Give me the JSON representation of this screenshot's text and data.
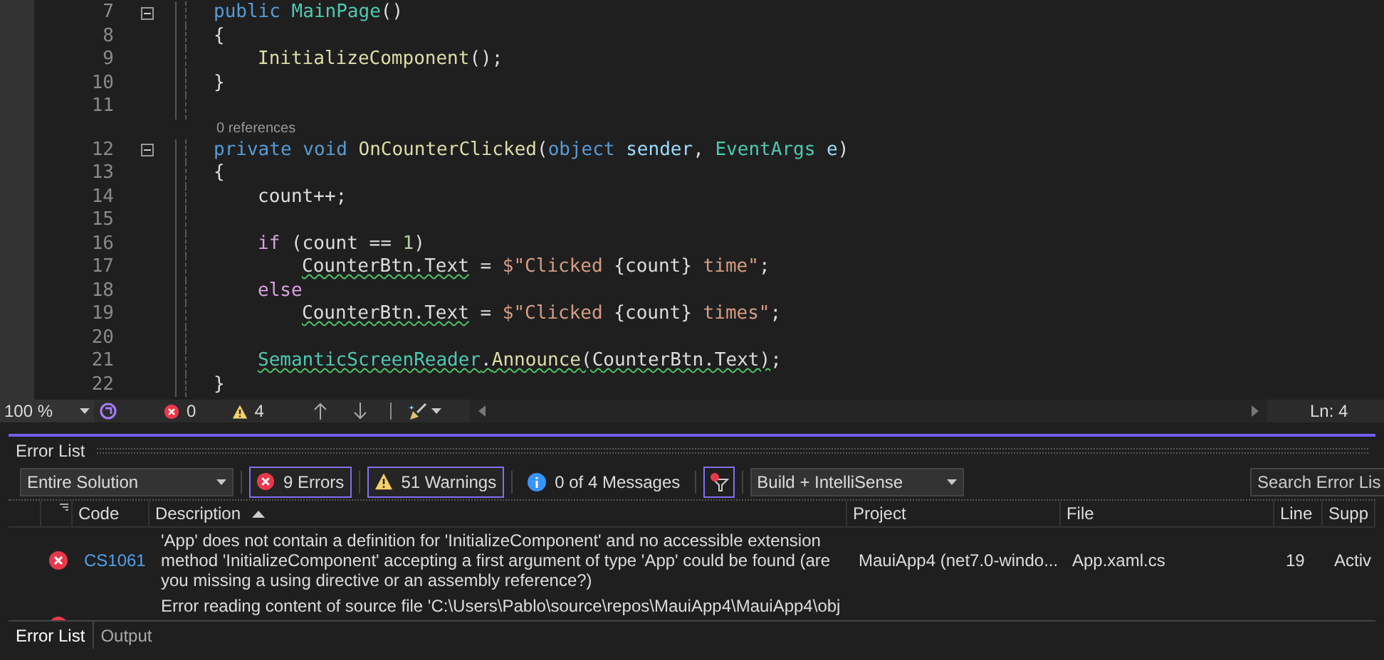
{
  "editor": {
    "lines": [
      {
        "number": "7",
        "fold": true,
        "tokens": [
          {
            "text": "public ",
            "kind": "kw"
          },
          {
            "text": "MainPage",
            "kind": "type"
          },
          {
            "text": "()",
            "kind": "plain"
          }
        ]
      },
      {
        "number": "8",
        "fold": false,
        "tokens": [
          {
            "text": "{",
            "kind": "plain"
          }
        ],
        "children": [
          {
            "number": "9",
            "fold": false,
            "tokens": [
              {
                "text": "InitializeComponent",
                "kind": "method"
              },
              {
                "text": "();",
                "kind": "plain"
              }
            ]
          }
        ]
      },
      {
        "number": "10",
        "fold": false,
        "tokens": [
          {
            "text": "}",
            "kind": "plain"
          }
        ]
      },
      {
        "number": "11",
        "fold": false
      },
      {
        "number": "12",
        "fold": true,
        "lens": "0 references",
        "tokens": [
          {
            "text": "private void ",
            "kind": "kw"
          },
          {
            "text": "OnCounterClicked",
            "kind": "method"
          },
          {
            "text": "(",
            "kind": "plain"
          },
          {
            "text": "object ",
            "kind": "kw"
          },
          {
            "text": "sender",
            "kind": "param"
          },
          {
            "text": ", ",
            "kind": "plain"
          },
          {
            "text": "EventArgs ",
            "kind": "type"
          },
          {
            "text": "e",
            "kind": "param"
          },
          {
            "text": ")",
            "kind": "plain"
          }
        ]
      },
      {
        "number": "13",
        "fold": false,
        "tokens": [
          {
            "text": "{",
            "kind": "plain"
          }
        ],
        "children": [
          {
            "number": "14",
            "fold": false,
            "tokens": [
              {
                "text": "count++;",
                "kind": "plain"
              }
            ]
          },
          {
            "number": "15",
            "fold": false
          },
          {
            "number": "16",
            "fold": false,
            "tokens": [
              {
                "text": "if ",
                "kind": "ctrl"
              },
              {
                "text": "(count == ",
                "kind": "plain"
              },
              {
                "text": "1",
                "kind": "num"
              },
              {
                "text": ")",
                "kind": "plain"
              }
            ],
            "children": [
              {
                "number": "17",
                "fold": false,
                "tokens": [
                  {
                    "text": "CounterBtn.Text",
                    "kind": "plain",
                    "squiggle": true
                  },
                  {
                    "text": " = ",
                    "kind": "plain"
                  },
                  {
                    "text": "$\"Clicked ",
                    "kind": "str"
                  },
                  {
                    "text": "{count}",
                    "kind": "plain"
                  },
                  {
                    "text": " time\"",
                    "kind": "str"
                  },
                  {
                    "text": ";",
                    "kind": "plain"
                  }
                ]
              }
            ]
          },
          {
            "number": "18",
            "fold": false,
            "tokens": [
              {
                "text": "else",
                "kind": "ctrl"
              }
            ],
            "children": [
              {
                "number": "19",
                "fold": false,
                "tokens": [
                  {
                    "text": "CounterBtn.Text",
                    "kind": "plain",
                    "squiggle": true
                  },
                  {
                    "text": " = ",
                    "kind": "plain"
                  },
                  {
                    "text": "$\"Clicked ",
                    "kind": "str"
                  },
                  {
                    "text": "{count}",
                    "kind": "plain"
                  },
                  {
                    "text": " times\"",
                    "kind": "str"
                  },
                  {
                    "text": ";",
                    "kind": "plain"
                  }
                ]
              }
            ]
          },
          {
            "number": "20",
            "fold": false
          },
          {
            "number": "21",
            "fold": false,
            "tokens": [
              {
                "text": "SemanticScreenReader",
                "kind": "type",
                "squiggle": true
              },
              {
                "text": ".",
                "kind": "plain",
                "squiggle": true
              },
              {
                "text": "Announce",
                "kind": "method",
                "squiggle": true
              },
              {
                "text": "(CounterBtn.Text)",
                "kind": "plain",
                "squiggle": true
              },
              {
                "text": ";",
                "kind": "plain"
              }
            ]
          }
        ]
      },
      {
        "number": "22",
        "fold": false,
        "tokens": [
          {
            "text": "}",
            "kind": "plain"
          }
        ]
      }
    ]
  },
  "status_bar": {
    "zoom": "100 %",
    "errors": "0",
    "warnings": "4",
    "position": "Ln: 4"
  },
  "error_list": {
    "title": "Error List",
    "scope": "Entire Solution",
    "filters": [
      {
        "kind": "error",
        "label": "9 Errors",
        "selected": true
      },
      {
        "kind": "warning",
        "label": "51 Warnings",
        "selected": true
      },
      {
        "kind": "info",
        "label": "0 of 4 Messages",
        "selected": false
      }
    ],
    "filter_active": true,
    "source": "Build + IntelliSense",
    "search": {
      "placeholder": "Search Error Lis"
    },
    "columns": [
      "Code",
      "Description",
      "Project",
      "File",
      "Line",
      "Supp"
    ],
    "rows": [
      {
        "kind": "error",
        "code": "CS1061",
        "description": "'App' does not contain a definition for 'InitializeComponent' and no accessible extension method 'InitializeComponent' accepting a first argument of type 'App' could be found (are you missing a using directive or an assembly reference?)",
        "project": "MauiApp4 (net7.0-windo...",
        "file": "App.xaml.cs",
        "line": "19",
        "suppression": "Activ"
      },
      {
        "kind": "error",
        "description": "Error reading content of source file 'C:\\Users\\Pablo\\source\\repos\\MauiApp4\\MauiApp4\\obj"
      }
    ],
    "tabs": [
      {
        "label": "Error List",
        "selected": true
      },
      {
        "label": "Output",
        "selected": false
      }
    ]
  }
}
